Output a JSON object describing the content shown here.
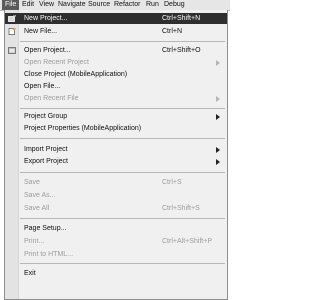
{
  "menubar": {
    "items": [
      "File",
      "Edit",
      "View",
      "Navigate",
      "Source",
      "Refactor",
      "Run",
      "Debug"
    ]
  },
  "file_menu": {
    "new_project": {
      "label": "New Project...",
      "shortcut": "Ctrl+Shift+N"
    },
    "new_file": {
      "label": "New File...",
      "shortcut": "Ctrl+N"
    },
    "open_project": {
      "label": "Open Project...",
      "shortcut": "Ctrl+Shift+O"
    },
    "open_recent_project": {
      "label": "Open Recent Project"
    },
    "close_project": {
      "label": "Close Project (MobileApplication)"
    },
    "open_file": {
      "label": "Open File..."
    },
    "open_recent_file": {
      "label": "Open Recent File"
    },
    "project_group": {
      "label": "Project Group"
    },
    "project_properties": {
      "label": "Project Properties (MobileApplication)"
    },
    "import_project": {
      "label": "Import Project"
    },
    "export_project": {
      "label": "Export Project"
    },
    "save": {
      "label": "Save",
      "shortcut": "Ctrl+S"
    },
    "save_as": {
      "label": "Save As..."
    },
    "save_all": {
      "label": "Save All",
      "shortcut": "Ctrl+Shift+S"
    },
    "page_setup": {
      "label": "Page Setup..."
    },
    "print": {
      "label": "Print...",
      "shortcut": "Ctrl+Alt+Shift+P"
    },
    "print_to_html": {
      "label": "Print to HTML..."
    },
    "exit": {
      "label": "Exit"
    }
  }
}
